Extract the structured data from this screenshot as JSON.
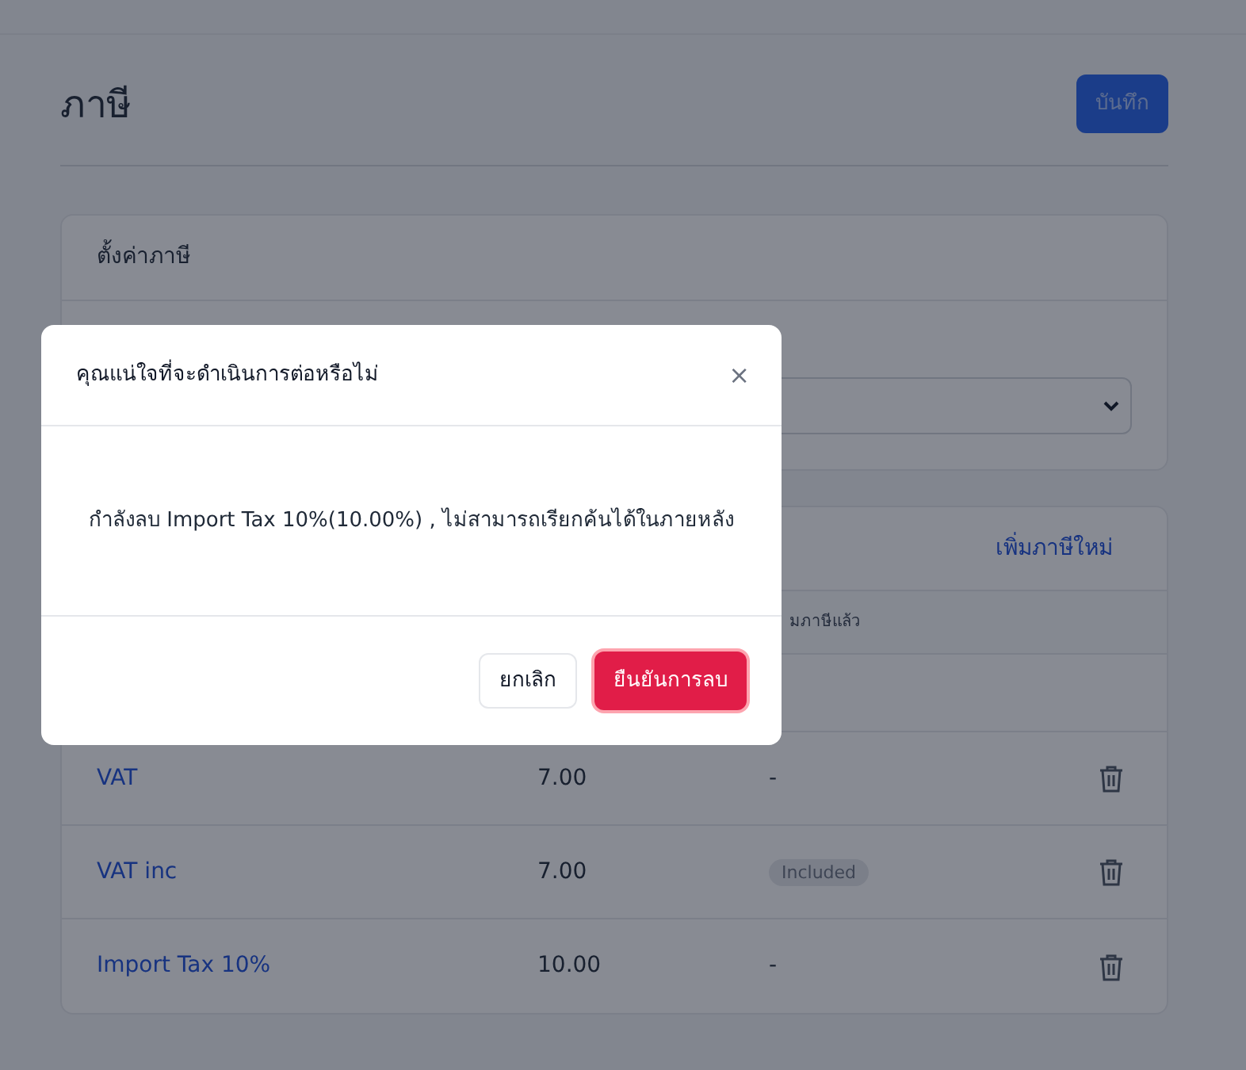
{
  "page": {
    "title": "ภาษี",
    "save_button": "บันทึก"
  },
  "settings_card": {
    "title": "ตั้งค่าภาษี"
  },
  "tax_card": {
    "add_link": "เพิ่มภาษีใหม่",
    "columns": [
      "",
      "",
      "มภาษีแล้ว"
    ],
    "rows": [
      {
        "name": "",
        "rate": "",
        "included": ""
      },
      {
        "name": "VAT",
        "rate": "7.00",
        "included": "-"
      },
      {
        "name": "VAT inc",
        "rate": "7.00",
        "included": "Included",
        "kind": "badge"
      },
      {
        "name": "Import Tax 10%",
        "rate": "10.00",
        "included": "-"
      }
    ]
  },
  "dialog": {
    "title": "คุณแน่ใจที่จะดำเนินการต่อหรือไม่",
    "close": "×",
    "message": "กำลังลบ Import Tax 10%(10.00%) , ไม่สามารถเรียกค้นได้ในภายหลัง",
    "cancel": "ยกเลิก",
    "confirm": "ยืนยันการลบ"
  }
}
